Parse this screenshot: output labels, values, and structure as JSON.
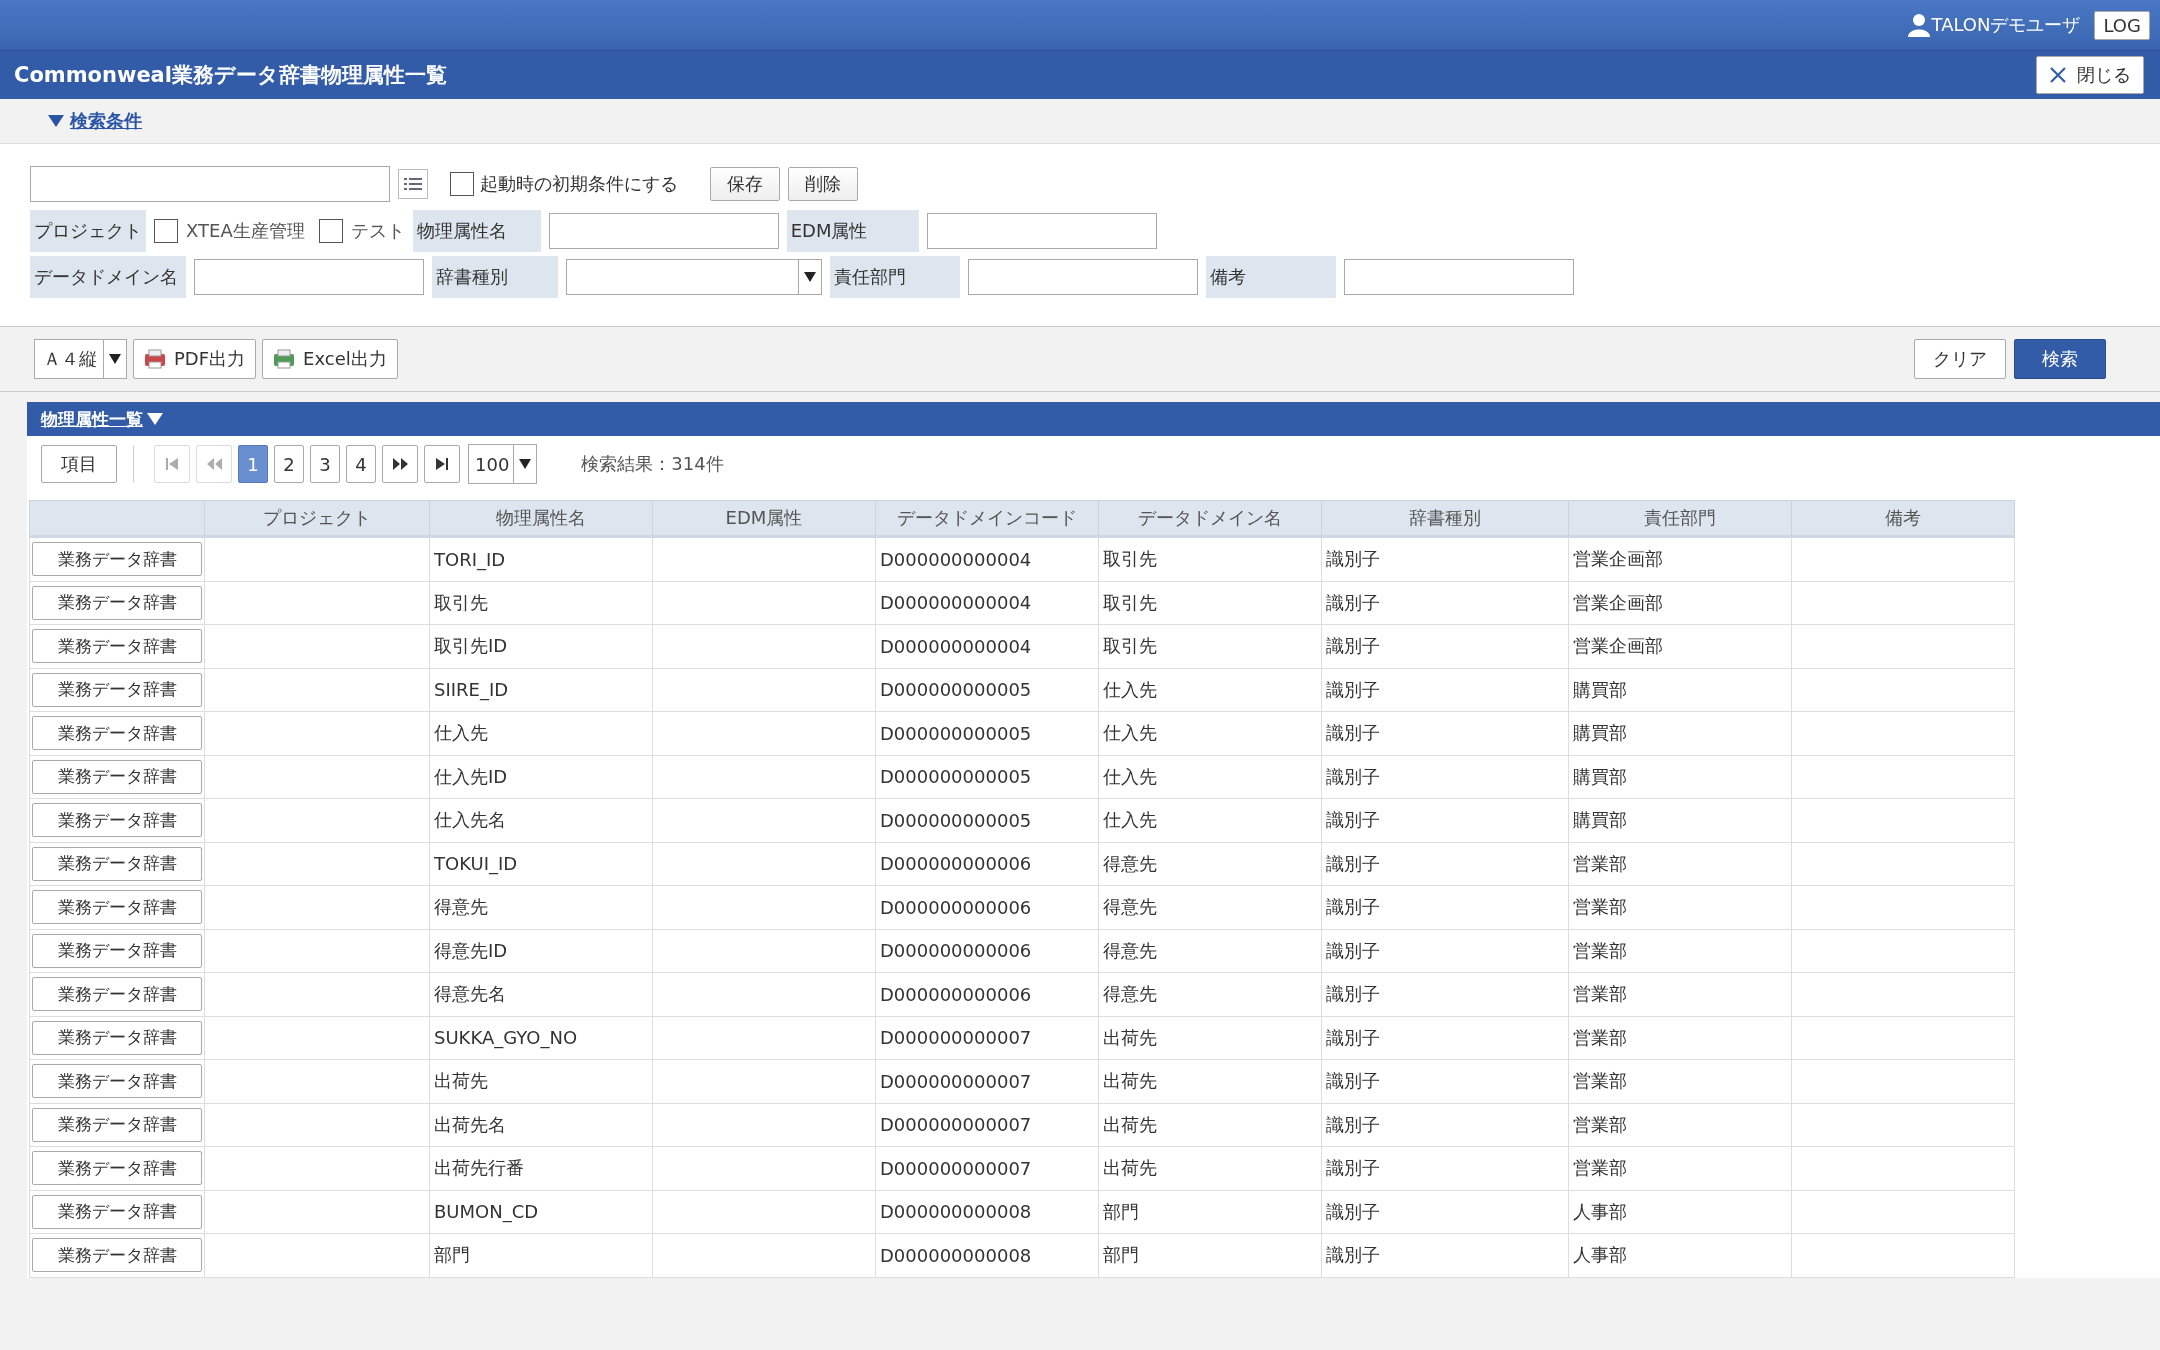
{
  "header": {
    "user": "TALONデモユーザ",
    "logout_button": "LOG"
  },
  "window": {
    "title": "Commonweal業務データ辞書物理属性一覧",
    "close_button": "閉じる"
  },
  "search_toggle": {
    "label": "検索条件",
    "expanded": true
  },
  "saved_condition": {
    "default_checkbox": {
      "label": "起動時の初期条件にする",
      "checked": false
    },
    "buttons": [
      "保存",
      "削除"
    ]
  },
  "filter_rows": [
    [
      {
        "label": "プロジェクト",
        "kind": "checkboxes",
        "options": [
          {
            "label": "XTEA生産管理",
            "checked": false
          },
          {
            "label": "テスト",
            "checked": false
          }
        ]
      },
      {
        "label": "物理属性名",
        "kind": "text"
      },
      {
        "label": "EDM属性",
        "kind": "text"
      }
    ],
    [
      {
        "label": "データドメイン名",
        "kind": "text"
      },
      {
        "label": "辞書種別",
        "kind": "select"
      },
      {
        "label": "責任部門",
        "kind": "text"
      },
      {
        "label": "備考",
        "kind": "text"
      }
    ]
  ],
  "toolbar": {
    "paper_size": "Ａ４縦",
    "buttons": [
      {
        "label": "PDF出力",
        "kind": "pdf"
      },
      {
        "label": "Excel出力",
        "kind": "excel"
      }
    ],
    "clear_button": "クリア",
    "search_button": "検索"
  },
  "results": {
    "title": "物理属性一覧",
    "expanded": true,
    "columns_button": "項目",
    "nav": [
      {
        "kind": "first",
        "disabled": true
      },
      {
        "kind": "prev",
        "disabled": true
      },
      {
        "kind": "next",
        "disabled": false
      },
      {
        "kind": "last",
        "disabled": false
      }
    ],
    "pages": [
      {
        "label": "1",
        "selected": true
      },
      {
        "label": "2",
        "selected": false
      },
      {
        "label": "3",
        "selected": false
      },
      {
        "label": "4",
        "selected": false
      }
    ],
    "page_size": "100",
    "result_count": "検索結果：314件",
    "columns": [
      "プロジェクト",
      "物理属性名",
      "EDM属性",
      "データドメインコード",
      "データドメイン名",
      "辞書種別",
      "責任部門",
      "備考"
    ],
    "rows": [
      {
        "button": "業務データ辞書",
        "name": "TORI_ID",
        "code": "D000000000004",
        "domain": "取引先",
        "type": "識別子",
        "dept": "営業企画部"
      },
      {
        "button": "業務データ辞書",
        "name": "取引先",
        "code": "D000000000004",
        "domain": "取引先",
        "type": "識別子",
        "dept": "営業企画部"
      },
      {
        "button": "業務データ辞書",
        "name": "取引先ID",
        "code": "D000000000004",
        "domain": "取引先",
        "type": "識別子",
        "dept": "営業企画部"
      },
      {
        "button": "業務データ辞書",
        "name": "SIIRE_ID",
        "code": "D000000000005",
        "domain": "仕入先",
        "type": "識別子",
        "dept": "購買部"
      },
      {
        "button": "業務データ辞書",
        "name": "仕入先",
        "code": "D000000000005",
        "domain": "仕入先",
        "type": "識別子",
        "dept": "購買部"
      },
      {
        "button": "業務データ辞書",
        "name": "仕入先ID",
        "code": "D000000000005",
        "domain": "仕入先",
        "type": "識別子",
        "dept": "購買部"
      },
      {
        "button": "業務データ辞書",
        "name": "仕入先名",
        "code": "D000000000005",
        "domain": "仕入先",
        "type": "識別子",
        "dept": "購買部"
      },
      {
        "button": "業務データ辞書",
        "name": "TOKUI_ID",
        "code": "D000000000006",
        "domain": "得意先",
        "type": "識別子",
        "dept": "営業部"
      },
      {
        "button": "業務データ辞書",
        "name": "得意先",
        "code": "D000000000006",
        "domain": "得意先",
        "type": "識別子",
        "dept": "営業部"
      },
      {
        "button": "業務データ辞書",
        "name": "得意先ID",
        "code": "D000000000006",
        "domain": "得意先",
        "type": "識別子",
        "dept": "営業部"
      },
      {
        "button": "業務データ辞書",
        "name": "得意先名",
        "code": "D000000000006",
        "domain": "得意先",
        "type": "識別子",
        "dept": "営業部"
      },
      {
        "button": "業務データ辞書",
        "name": "SUKKA_GYO_NO",
        "code": "D000000000007",
        "domain": "出荷先",
        "type": "識別子",
        "dept": "営業部"
      },
      {
        "button": "業務データ辞書",
        "name": "出荷先",
        "code": "D000000000007",
        "domain": "出荷先",
        "type": "識別子",
        "dept": "営業部"
      },
      {
        "button": "業務データ辞書",
        "name": "出荷先名",
        "code": "D000000000007",
        "domain": "出荷先",
        "type": "識別子",
        "dept": "営業部"
      },
      {
        "button": "業務データ辞書",
        "name": "出荷先行番",
        "code": "D000000000007",
        "domain": "出荷先",
        "type": "識別子",
        "dept": "営業部"
      },
      {
        "button": "業務データ辞書",
        "name": "BUMON_CD",
        "code": "D000000000008",
        "domain": "部門",
        "type": "識別子",
        "dept": "人事部"
      },
      {
        "button": "業務データ辞書",
        "name": "部門",
        "code": "D000000000008",
        "domain": "部門",
        "type": "識別子",
        "dept": "人事部"
      }
    ]
  }
}
